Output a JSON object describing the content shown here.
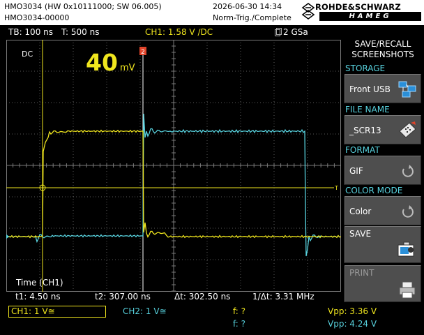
{
  "header": {
    "model_line": "HMO3034 (HW 0x10111000; SW 06.005)",
    "serial_line": "HMO3034-00000",
    "datetime": "2026-06-30 14:34",
    "trigger_state": "Norm-Trig./Complete",
    "brand_line1": "ROHDE&SCHWARZ",
    "brand_line2": "HAMEG"
  },
  "info_bar": {
    "timebase": "TB: 100 ns",
    "trigger_time": "T: 500 ns",
    "trigger_setting": "CH1: 1.58 V ∕DC",
    "sample_rate": "2 GSa"
  },
  "screen": {
    "coupling": "DC",
    "big_value": "40",
    "big_unit": "mV",
    "cursor2_marker": "2",
    "time_label": "Time (CH1)",
    "t1": "t1: 4.50 ns",
    "t2": "t2: 307.00 ns",
    "dt": "Δt: 302.50 ns",
    "inv_dt": "1/Δt: 3.31 MHz",
    "trigger_level_marker": "T"
  },
  "menu": {
    "title_line1": "SAVE/RECALL",
    "title_line2": "SCREENSHOTS",
    "storage_label": "STORAGE",
    "storage_value": "Front USB",
    "filename_label": "FILE NAME",
    "filename_value": "_SCR13",
    "format_label": "FORMAT",
    "format_value": "GIF",
    "colormode_label": "COLOR MODE",
    "colormode_value": "Color",
    "save_label": "SAVE",
    "print_label": "PRINT"
  },
  "status": {
    "ch1": "CH1: 1 V≅",
    "ch2": "CH2: 1 V≅",
    "f1": "f: ?",
    "f2": "f: ?",
    "vpp1": "Vpp: 3.36 V",
    "vpp2": "Vpp: 4.24 V"
  },
  "colors": {
    "ch1": "#f0e61e",
    "ch2": "#58d2de",
    "cursor2": "#e0442a",
    "grid": "#5a5a5a"
  }
}
